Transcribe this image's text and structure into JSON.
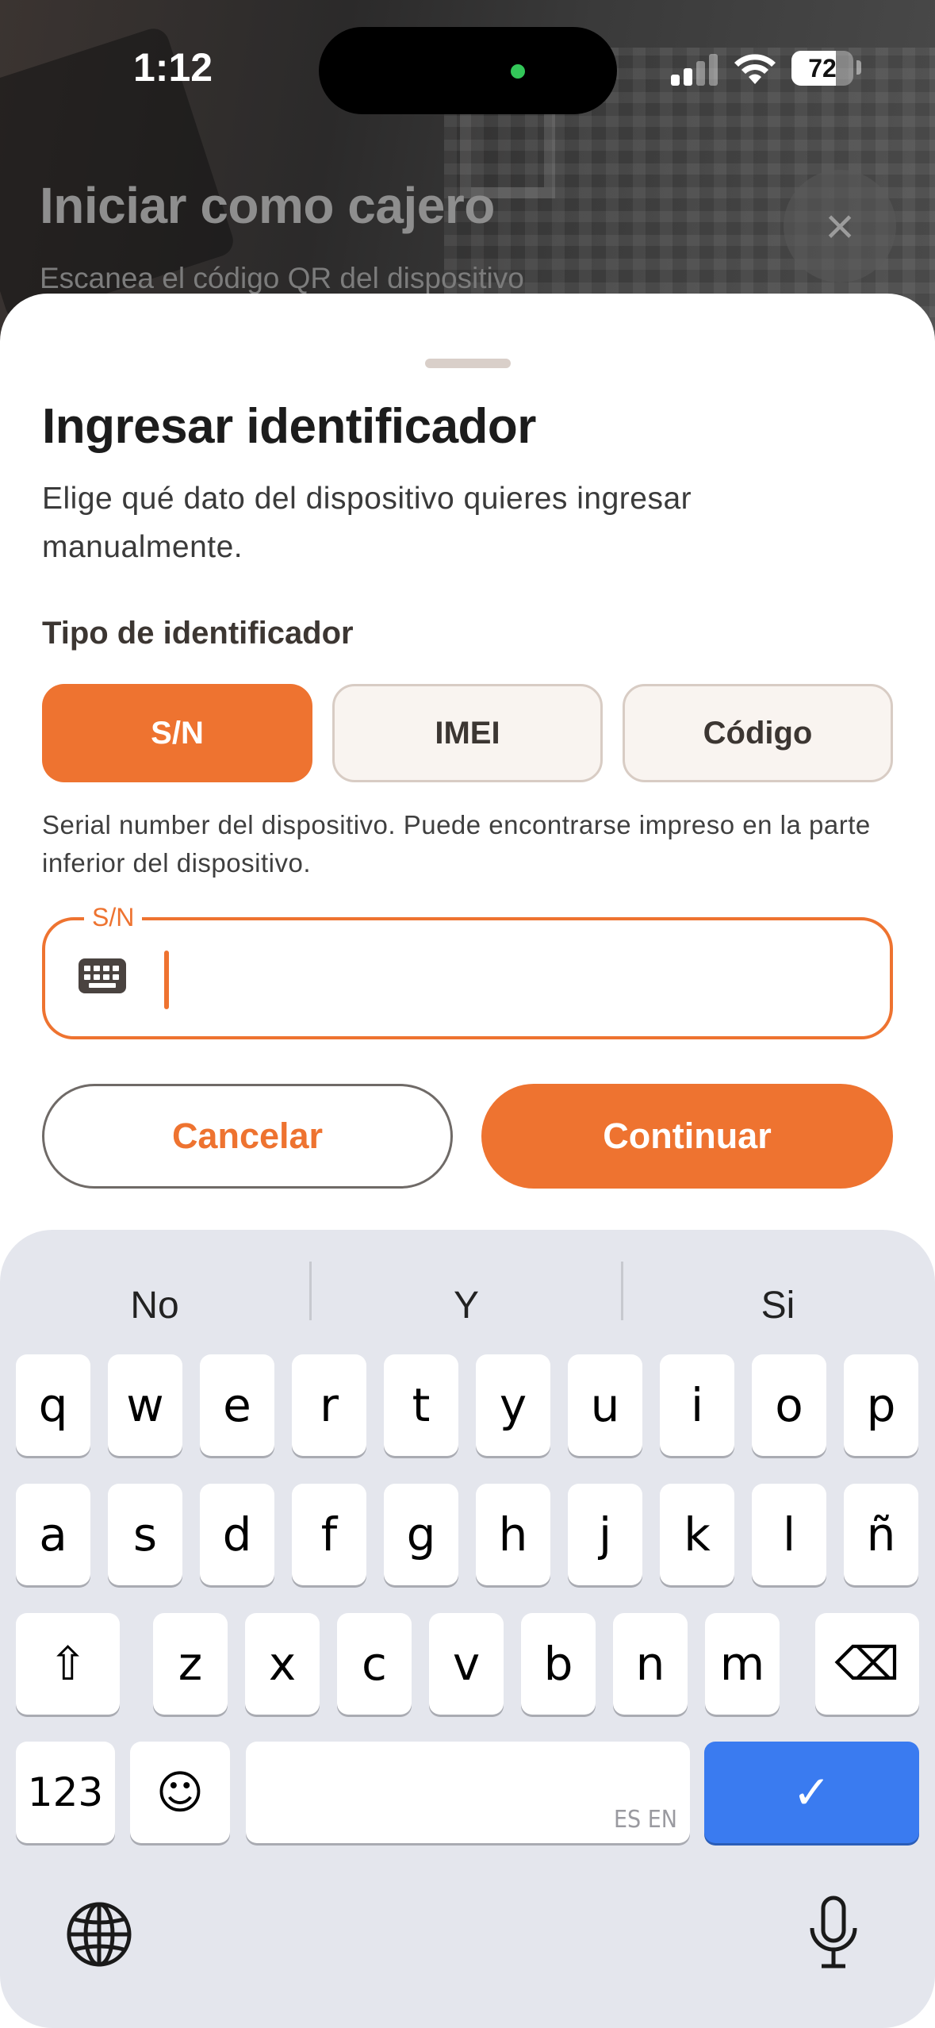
{
  "status_bar": {
    "time": "1:12",
    "battery": "72",
    "battery_level": 0.72,
    "colors": {
      "active_dot": "#33c759"
    }
  },
  "background": {
    "title": "Iniciar como cajero",
    "subtitle": "Escanea el código QR del dispositivo",
    "close_icon": "×"
  },
  "sheet": {
    "title": "Ingresar identificador",
    "description": "Elige qué dato del dispositivo quieres ingresar manualmente.",
    "section_label": "Tipo de identificador",
    "options": [
      {
        "label": "S/N",
        "selected": true
      },
      {
        "label": "IMEI",
        "selected": false
      },
      {
        "label": "Código",
        "selected": false
      }
    ],
    "helper": "Serial number del dispositivo. Puede encontrarse impreso en la parte inferior del dispositivo.",
    "field": {
      "legend": "S/N",
      "value": "",
      "icon": "keyboard-icon"
    },
    "cancel_label": "Cancelar",
    "continue_label": "Continuar",
    "colors": {
      "accent": "#ee7330",
      "inactive_bg": "#f9f4f0"
    }
  },
  "keyboard": {
    "suggestions": [
      "No",
      "Y",
      "Si"
    ],
    "row1": [
      "q",
      "w",
      "e",
      "r",
      "t",
      "y",
      "u",
      "i",
      "o",
      "p"
    ],
    "row2": [
      "a",
      "s",
      "d",
      "f",
      "g",
      "h",
      "j",
      "k",
      "l",
      "ñ"
    ],
    "row3": [
      "z",
      "x",
      "c",
      "v",
      "b",
      "n",
      "m"
    ],
    "numbers_label": "123",
    "emoji_icon": "☺",
    "space_lang": "ES EN",
    "confirm_icon": "✓",
    "shift_icon": "⇧",
    "delete_icon": "⌫",
    "colors": {
      "confirm": "#3a7bf0",
      "background": "#e4e6ed"
    }
  }
}
